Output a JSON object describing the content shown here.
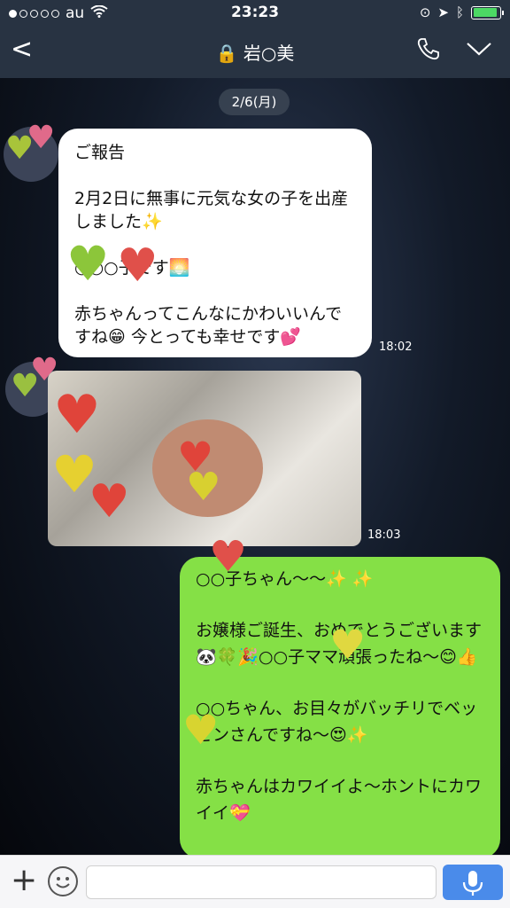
{
  "status": {
    "carrier": "au",
    "time": "23:23"
  },
  "nav": {
    "back": "<",
    "title": "岩○美",
    "phone_icon": "phone-icon",
    "menu_icon": "chevron-down-icon"
  },
  "chat": {
    "date_label": "2/6(月)",
    "messages": [
      {
        "side": "left",
        "lines": [
          "ご報告",
          "2月2日に無事に元気な女の子を出産しました✨",
          "○○○子です🌅",
          "赤ちゃんってこんなにかわいいんですね😁 今とっても幸せです💕"
        ],
        "time": "18:02"
      },
      {
        "side": "left",
        "type": "photo",
        "time": "18:03"
      },
      {
        "side": "right",
        "lines": [
          "○○子ちゃん〜〜✨ ✨",
          "お嬢様ご誕生、おめでとうございます 🐼🍀🎉○○子ママ頑張ったね〜😊👍",
          "○○ちゃん、お目々がバッチリでベッピンさんですね〜😍✨",
          "赤ちゃんはカワイイよ〜ホントにカワイイ💝"
        ]
      }
    ]
  },
  "input": {
    "plus": "+",
    "emoji_icon": "smile-icon",
    "mic_icon": "mic-icon",
    "placeholder": ""
  },
  "colors": {
    "nav": "#283342",
    "green_bubble": "#85e046",
    "accent": "#4a8bea"
  }
}
